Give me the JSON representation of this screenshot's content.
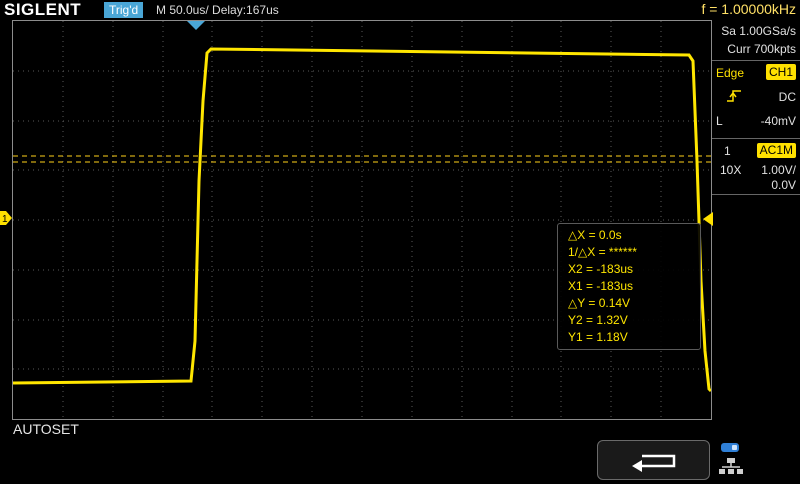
{
  "header": {
    "logo": "SIGLENT",
    "trigger_status": "Trig'd",
    "timebase": "M 50.0us/  Delay:167us",
    "frequency": "f = 1.00000kHz"
  },
  "acquisition": {
    "sample_rate": "Sa 1.00GSa/s",
    "memory_depth": "Curr 700kpts"
  },
  "trigger": {
    "type": "Edge",
    "source": "CH1",
    "slope_icon": "rising-edge-icon",
    "coupling": "DC",
    "level_label": "L",
    "level": "-40mV"
  },
  "channel1": {
    "number": "1",
    "coupling": "AC1M",
    "probe": "10X",
    "scale": "1.00V/",
    "offset": "0.0V"
  },
  "measurements": {
    "rows": [
      "△X = 0.0s",
      "1/△X = ******",
      "X2 = -183us",
      "X1 = -183us",
      "△Y = 0.14V",
      "Y2 = 1.32V",
      "Y1 = 1.18V"
    ]
  },
  "status": {
    "last_action": "AUTOSET"
  },
  "icons": {
    "back": "return-arrow-icon",
    "network": "network-icon"
  },
  "colors": {
    "trace": "#ffe600",
    "accent": "#4aa6d6",
    "channel1": "#ffe100"
  }
}
